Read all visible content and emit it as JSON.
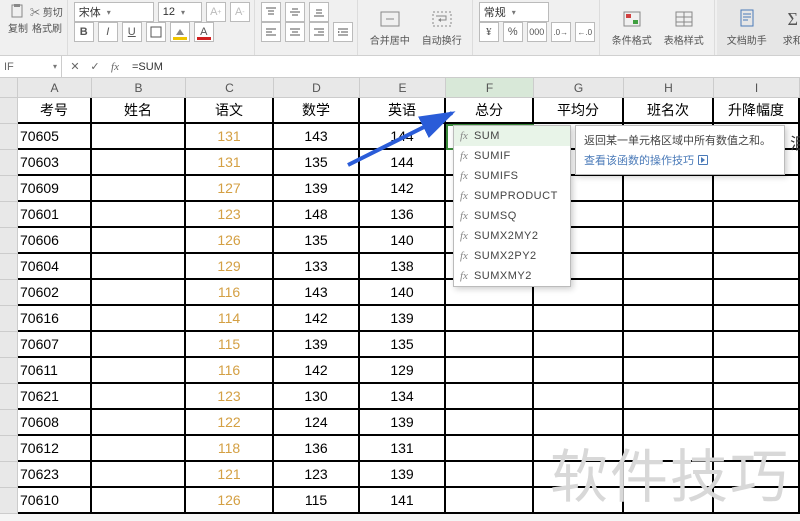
{
  "ribbon": {
    "cut": "剪切",
    "copy": "复制",
    "format_painter": "格式刷",
    "font_name": "宋体",
    "font_size": "12",
    "merge_center": "合并居中",
    "auto_wrap": "自动换行",
    "number_format": "常规",
    "cond_format": "条件格式",
    "table_style": "表格样式",
    "doc_assist": "文档助手",
    "sum": "求和"
  },
  "formula_bar": {
    "name_box": "IF",
    "formula": "=SUM"
  },
  "columns": [
    "A",
    "B",
    "C",
    "D",
    "E",
    "F",
    "G",
    "H",
    "I"
  ],
  "header_row": [
    "考号",
    "姓名",
    "语文",
    "数学",
    "英语",
    "总分",
    "平均分",
    "班名次",
    "升降幅度"
  ],
  "editing_cell": "=SUM",
  "rows": [
    {
      "id": "70605",
      "c": "131",
      "d": "143",
      "e": "144"
    },
    {
      "id": "70603",
      "c": "131",
      "d": "135",
      "e": "144"
    },
    {
      "id": "70609",
      "c": "127",
      "d": "139",
      "e": "142"
    },
    {
      "id": "70601",
      "c": "123",
      "d": "148",
      "e": "136"
    },
    {
      "id": "70606",
      "c": "126",
      "d": "135",
      "e": "140"
    },
    {
      "id": "70604",
      "c": "129",
      "d": "133",
      "e": "138"
    },
    {
      "id": "70602",
      "c": "116",
      "d": "143",
      "e": "140"
    },
    {
      "id": "70616",
      "c": "114",
      "d": "142",
      "e": "139"
    },
    {
      "id": "70607",
      "c": "115",
      "d": "139",
      "e": "135"
    },
    {
      "id": "70611",
      "c": "116",
      "d": "142",
      "e": "129"
    },
    {
      "id": "70621",
      "c": "123",
      "d": "130",
      "e": "134"
    },
    {
      "id": "70608",
      "c": "122",
      "d": "124",
      "e": "139"
    },
    {
      "id": "70612",
      "c": "118",
      "d": "136",
      "e": "131"
    },
    {
      "id": "70623",
      "c": "121",
      "d": "123",
      "e": "139"
    },
    {
      "id": "70610",
      "c": "126",
      "d": "115",
      "e": "141"
    }
  ],
  "autocomplete": {
    "items": [
      {
        "fx": "fx",
        "name": "SUM",
        "selected": true
      },
      {
        "fx": "fx",
        "name": "SUMIF"
      },
      {
        "fx": "fx",
        "name": "SUMIFS"
      },
      {
        "fx": "fx",
        "name": "SUMPRODUCT"
      },
      {
        "fx": "fx",
        "name": "SUMSQ"
      },
      {
        "fx": "fx",
        "name": "SUMX2MY2"
      },
      {
        "fx": "fx",
        "name": "SUMX2PY2"
      },
      {
        "fx": "fx",
        "name": "SUMXMY2"
      }
    ],
    "hint_desc": "返回某一单元格区域中所有数值之和。",
    "hint_link": "查看该函数的操作技巧"
  },
  "edge_char": "泪",
  "watermark": "软件技巧"
}
